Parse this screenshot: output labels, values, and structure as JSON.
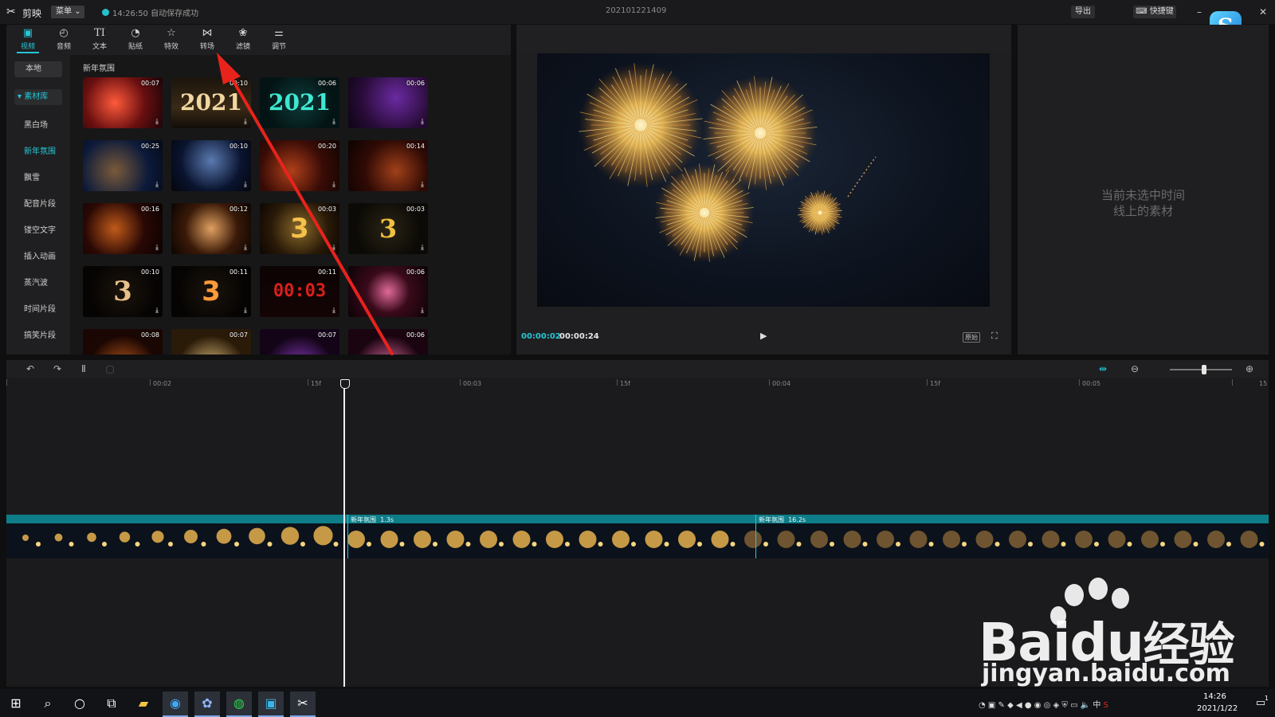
{
  "titlebar": {
    "app_name": "剪映",
    "menu_label": "菜单",
    "save_status": "14:26:50 自动保存成功",
    "project_name": "202101221409",
    "export_label": "导出",
    "shortcut_label": "快捷键"
  },
  "tool_tabs": [
    {
      "label": "视频",
      "icon": "video-icon"
    },
    {
      "label": "音频",
      "icon": "audio-icon"
    },
    {
      "label": "文本",
      "icon": "text-icon"
    },
    {
      "label": "贴纸",
      "icon": "sticker-icon"
    },
    {
      "label": "特效",
      "icon": "effects-icon"
    },
    {
      "label": "转场",
      "icon": "transition-icon"
    },
    {
      "label": "滤镜",
      "icon": "filter-icon"
    },
    {
      "label": "调节",
      "icon": "adjust-icon"
    }
  ],
  "side_nav": {
    "local": "本地",
    "library": "素材库",
    "items": [
      "黑白场",
      "新年氛围",
      "飘雪",
      "配音片段",
      "镂空文字",
      "插入动画",
      "蒸汽波",
      "时间片段",
      "搞笑片段"
    ],
    "selected": "新年氛围"
  },
  "grid": {
    "title": "新年氛围",
    "thumbs": [
      {
        "dur": "00:07",
        "text": ""
      },
      {
        "dur": "00:10",
        "text": "2021"
      },
      {
        "dur": "00:06",
        "text": "2021"
      },
      {
        "dur": "00:06",
        "text": ""
      },
      {
        "dur": "00:25",
        "text": ""
      },
      {
        "dur": "00:10",
        "text": ""
      },
      {
        "dur": "00:20",
        "text": ""
      },
      {
        "dur": "00:14",
        "text": ""
      },
      {
        "dur": "00:16",
        "text": ""
      },
      {
        "dur": "00:12",
        "text": ""
      },
      {
        "dur": "00:03",
        "text": "3"
      },
      {
        "dur": "00:03",
        "text": "3"
      },
      {
        "dur": "00:10",
        "text": "3"
      },
      {
        "dur": "00:11",
        "text": "3"
      },
      {
        "dur": "00:11",
        "text": "00:03"
      },
      {
        "dur": "00:06",
        "text": ""
      },
      {
        "dur": "00:08",
        "text": ""
      },
      {
        "dur": "00:07",
        "text": ""
      },
      {
        "dur": "00:07",
        "text": ""
      },
      {
        "dur": "00:06",
        "text": ""
      }
    ]
  },
  "preview": {
    "current_time": "00:00:02",
    "total_time": "00:00:24",
    "ratio_label": "原始"
  },
  "properties": {
    "empty_line1": "当前未选中时间",
    "empty_line2": "线上的素材"
  },
  "timeline": {
    "ruler": [
      "00:02",
      "15f",
      "00:03",
      "15f",
      "00:04",
      "15f",
      "00:05",
      "15"
    ],
    "segments": [
      {
        "name": "新年氛围",
        "dur": "1.3s"
      },
      {
        "name": "新年氛围",
        "dur": "16.2s"
      }
    ]
  },
  "watermark": {
    "brand": "Bai",
    "brand2": "du",
    "brand3": "经验",
    "url": "jingyan.baidu.com"
  },
  "taskbar": {
    "time": "14:26",
    "date": "2021/1/22",
    "ime": "中",
    "notif_count": "1"
  },
  "colors": {
    "accent": "#26c6d6",
    "track": "#0e7d88",
    "arrow": "#e8231c"
  }
}
